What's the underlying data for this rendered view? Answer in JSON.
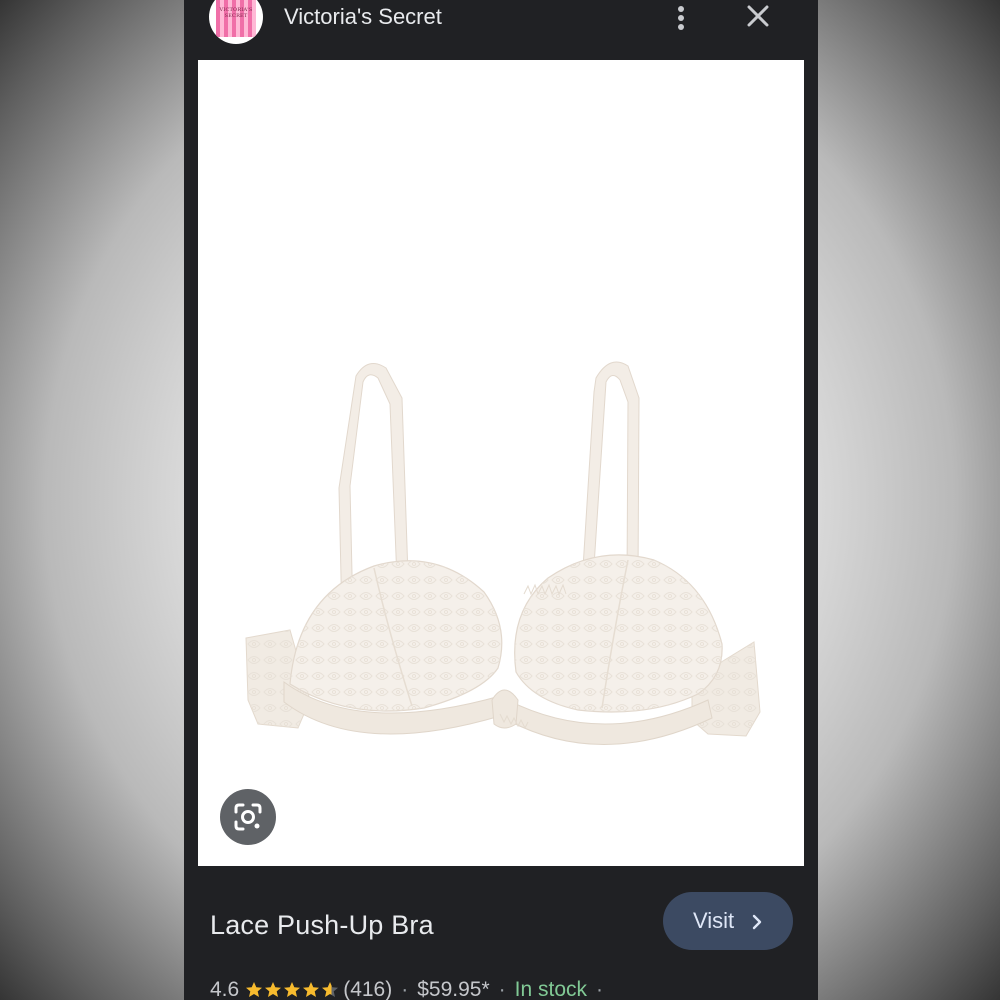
{
  "header": {
    "site_name": "Victoria's Secret",
    "logo_text": "VICTORIA'S SECRET",
    "icons": [
      "more-vert-icon",
      "close-icon"
    ]
  },
  "main": {
    "image_alt": "Lace Push-Up Bra product photo",
    "lens_icon": "google-lens-icon"
  },
  "product": {
    "title": "Lace Push-Up Bra",
    "visit_label": "Visit",
    "rating": "4.6",
    "rating_value": 4.6,
    "rating_max": 5,
    "review_count": "(416)",
    "price": "$59.95*",
    "availability": "In stock",
    "separator": "·"
  },
  "colors": {
    "panel_bg": "#202124",
    "visit_button_bg": "#3c4a62",
    "star": "#f7bb2e",
    "in_stock": "#81c995",
    "brand_pink": "#f06fa8"
  }
}
